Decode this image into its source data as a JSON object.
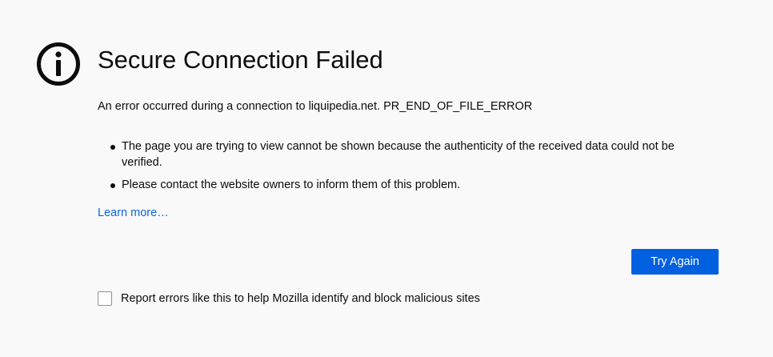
{
  "error_page": {
    "title": "Secure Connection Failed",
    "description": "An error occurred during a connection to liquipedia.net. PR_END_OF_FILE_ERROR",
    "bullets": [
      "The page you are trying to view cannot be shown because the authenticity of the received data could not be verified.",
      "Please contact the website owners to inform them of this problem."
    ],
    "learn_more": "Learn more…",
    "try_again_label": "Try Again",
    "report_label": "Report errors like this to help Mozilla identify and block malicious sites",
    "report_checked": false,
    "icon": "info-icon"
  },
  "colors": {
    "background": "#f9f9fa",
    "link": "#0a66d6",
    "primary_button": "#0060df",
    "text": "#0c0c0d"
  }
}
